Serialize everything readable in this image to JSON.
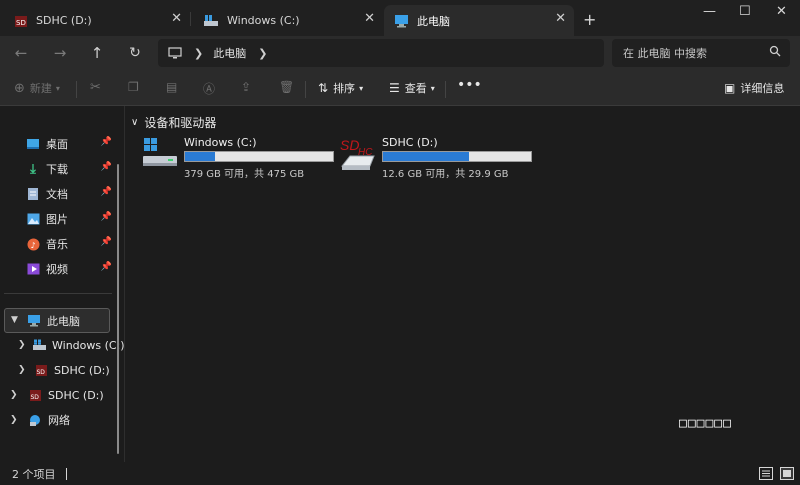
{
  "tabs": [
    {
      "label": "SDHC (D:)",
      "icon": "sdhc-drive-icon",
      "active": false
    },
    {
      "label": "Windows (C:)",
      "icon": "windows-drive-icon",
      "active": false
    },
    {
      "label": "此电脑",
      "icon": "this-pc-icon",
      "active": true
    }
  ],
  "address": {
    "crumb": "此电脑"
  },
  "search": {
    "placeholder": "在 此电脑 中搜索"
  },
  "commands": {
    "new_label": "新建",
    "sort_label": "排序",
    "view_label": "查看",
    "details_label": "详细信息"
  },
  "sidebar": {
    "quick": [
      {
        "label": "桌面",
        "icon": "desktop-folder-icon"
      },
      {
        "label": "下载",
        "icon": "downloads-folder-icon"
      },
      {
        "label": "文档",
        "icon": "documents-folder-icon"
      },
      {
        "label": "图片",
        "icon": "pictures-folder-icon"
      },
      {
        "label": "音乐",
        "icon": "music-folder-icon"
      },
      {
        "label": "视频",
        "icon": "videos-folder-icon"
      }
    ],
    "tree": [
      {
        "label": "此电脑",
        "icon": "this-pc-icon",
        "expanded": true,
        "selected": true
      },
      {
        "label": "Windows (C:)",
        "icon": "windows-drive-icon",
        "indent": true
      },
      {
        "label": "SDHC (D:)",
        "icon": "sdhc-drive-icon",
        "indent": true
      },
      {
        "label": "SDHC (D:)",
        "icon": "sdhc-drive-icon"
      },
      {
        "label": "网络",
        "icon": "network-icon"
      }
    ]
  },
  "content": {
    "group_header": "设备和驱动器",
    "drives": [
      {
        "name": "Windows (C:)",
        "free_text": "379 GB 可用，共 475 GB",
        "used_fraction": 0.2,
        "icon": "windows-drive-icon"
      },
      {
        "name": "SDHC (D:)",
        "free_text": "12.6 GB 可用，共 29.9 GB",
        "used_fraction": 0.58,
        "icon": "sdhc-drive-icon"
      }
    ],
    "garbled_text": "□□□□□□"
  },
  "status": {
    "item_count": "2 个项目"
  },
  "colors": {
    "accent": "#2a7bd4",
    "background": "#1c1c1c",
    "toolbar": "#2b2b2b"
  }
}
